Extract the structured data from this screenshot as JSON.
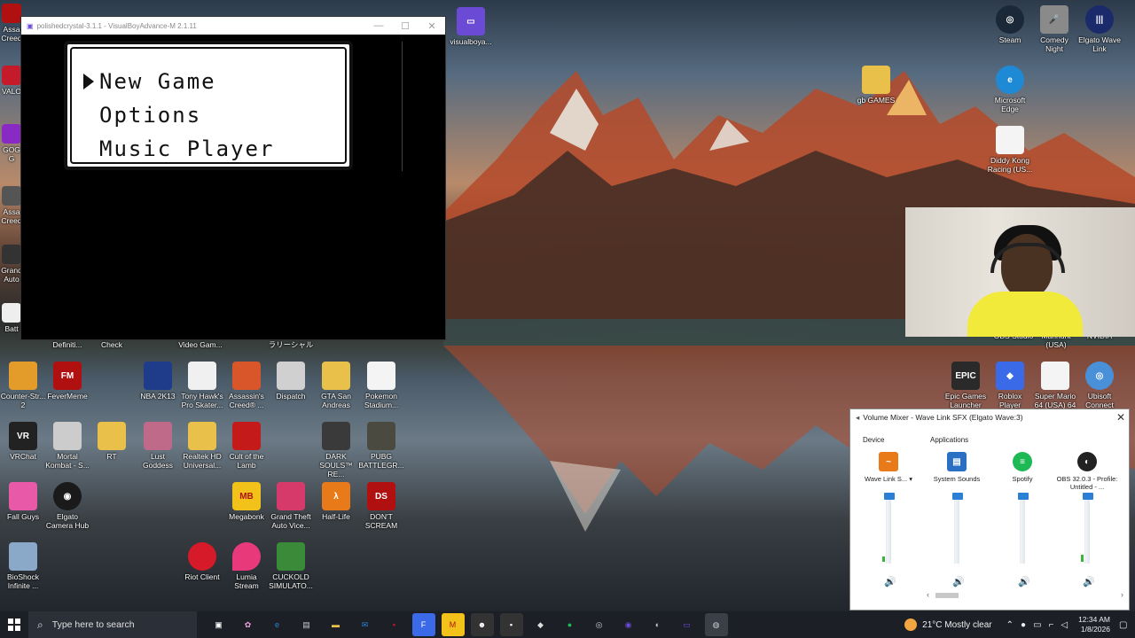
{
  "emulator": {
    "title": "polishedcrystal-3.1.1 - VisualBoyAdvance-M 2.1.11",
    "menu": [
      "New Game",
      "Options",
      "Music Player"
    ]
  },
  "desktop_icons": [
    {
      "key": "visualboy",
      "label": "visualboya...",
      "color": "#6b4bd6"
    },
    {
      "key": "steam",
      "label": "Steam",
      "color": "#1b2838"
    },
    {
      "key": "comedy",
      "label": "Comedy Night",
      "color": "#8a8a8a"
    },
    {
      "key": "elgato_wave",
      "label": "Elgato Wave Link",
      "color": "#1a2a6a"
    },
    {
      "key": "edge",
      "label": "Microsoft Edge",
      "color": "#1e8ad6"
    },
    {
      "key": "gb_games",
      "label": "gb GAMES",
      "color": "#e8c04a"
    },
    {
      "key": "diddy",
      "label": "Diddy Kong Racing (US...",
      "color": "#f4f4f4"
    },
    {
      "key": "obs_bg",
      "label": "OBS Studio",
      "color": "#333"
    },
    {
      "key": "manhunt",
      "label": "Manhunt (USA)",
      "color": "#555"
    },
    {
      "key": "nvidia",
      "label": "NVIDIA",
      "color": "#76b900"
    },
    {
      "key": "definiti",
      "label": "Definiti...",
      "color": "#555"
    },
    {
      "key": "check",
      "label": "Check",
      "color": "#555"
    },
    {
      "key": "videogam",
      "label": "Video Gam...",
      "color": "#555"
    },
    {
      "key": "jp",
      "label": "ラリーシャル",
      "color": "#555"
    },
    {
      "key": "cs",
      "label": "Counter-Str... 2",
      "color": "#e39b2a"
    },
    {
      "key": "fm",
      "label": "FeverMeme",
      "color": "#b01010"
    },
    {
      "key": "nba",
      "label": "NBA 2K13",
      "color": "#1e3c8a"
    },
    {
      "key": "thps",
      "label": "Tony Hawk's Pro Skater...",
      "color": "#f0f0f0"
    },
    {
      "key": "ac",
      "label": "Assassin's Creed® ...",
      "color": "#d9552a"
    },
    {
      "key": "dispatch",
      "label": "Dispatch",
      "color": "#d0d0d0"
    },
    {
      "key": "gta_sa",
      "label": "GTA San Andreas",
      "color": "#e8c04a"
    },
    {
      "key": "pokemon_stadium",
      "label": "Pokemon Stadium...",
      "color": "#f4f4f4"
    },
    {
      "key": "epic",
      "label": "Epic Games Launcher",
      "color": "#2a2a2a"
    },
    {
      "key": "roblox",
      "label": "Roblox Player",
      "color": "#3a6ae8"
    },
    {
      "key": "supermario",
      "label": "Super Mario 64 (USA) 64",
      "color": "#f4f4f4"
    },
    {
      "key": "ubisoft",
      "label": "Ubisoft Connect",
      "color": "#4a90d9"
    },
    {
      "key": "vrchat",
      "label": "VRChat",
      "color": "#222"
    },
    {
      "key": "mk",
      "label": "Mortal Kombat - S...",
      "color": "#ccc"
    },
    {
      "key": "rt",
      "label": "RT",
      "color": "#e8c04a"
    },
    {
      "key": "lust",
      "label": "Lust Goddess",
      "color": "#c06a8a"
    },
    {
      "key": "realtek",
      "label": "Realtek HD Universal...",
      "color": "#e8c04a"
    },
    {
      "key": "cult",
      "label": "Cult of the Lamb",
      "color": "#c41a1a"
    },
    {
      "key": "darksouls",
      "label": "DARK SOULS™ RE...",
      "color": "#3a3a3a"
    },
    {
      "key": "pubg",
      "label": "PUBG BATTLEGR...",
      "color": "#4a4a40"
    },
    {
      "key": "fallguys",
      "label": "Fall Guys",
      "color": "#e85aa8"
    },
    {
      "key": "elgato_cam",
      "label": "Elgato Camera Hub",
      "color": "#1a1a1a"
    },
    {
      "key": "megabonk",
      "label": "Megabonk",
      "color": "#f2c21a"
    },
    {
      "key": "gtav",
      "label": "Grand Theft Auto Vice...",
      "color": "#d63a6a"
    },
    {
      "key": "halflife",
      "label": "Half-Life",
      "color": "#e87a1a"
    },
    {
      "key": "dontscream",
      "label": "DON'T SCREAM",
      "color": "#b01010"
    },
    {
      "key": "bioshock",
      "label": "BioShock Infinite ...",
      "color": "#8aa8c8"
    },
    {
      "key": "riot",
      "label": "Riot Client",
      "color": "#d61a2a"
    },
    {
      "key": "lumia",
      "label": "Lumia Stream",
      "color": "#e83a7a"
    },
    {
      "key": "cuckold",
      "label": "CUCKOLD SIMULATO...",
      "color": "#3a8a3a"
    },
    {
      "key": "left_assas",
      "label": "Assa Creed",
      "color": "#b01010"
    },
    {
      "key": "left_valo",
      "label": "VALO",
      "color": "#c41a2a"
    },
    {
      "key": "left_gog",
      "label": "GOG G",
      "color": "#8a2ac4"
    },
    {
      "key": "left_assas2",
      "label": "Assa Creed",
      "color": "#555"
    },
    {
      "key": "left_grand",
      "label": "Grand Auto",
      "color": "#333"
    },
    {
      "key": "left_batt",
      "label": "Batt",
      "color": "#eee"
    }
  ],
  "mixer": {
    "title": "Volume Mixer - Wave Link SFX (Elgato Wave:3)",
    "device_header": "Device",
    "apps_header": "Applications",
    "columns": [
      {
        "name": "Wave Link S...",
        "level_pct": 8,
        "volume_pct": 100,
        "icon": "wave-link-icon",
        "color": "#e87a1a"
      },
      {
        "name": "System Sounds",
        "level_pct": 0,
        "volume_pct": 100,
        "icon": "system-sounds-icon",
        "color": "#2b6fc4"
      },
      {
        "name": "Spotify",
        "level_pct": 0,
        "volume_pct": 100,
        "icon": "spotify-icon",
        "color": "#1db954"
      },
      {
        "name": "OBS 32.0.3 - Profile: Untitled - ...",
        "level_pct": 10,
        "volume_pct": 100,
        "icon": "obs-icon",
        "color": "#222"
      }
    ]
  },
  "taskbar": {
    "search_placeholder": "Type here to search",
    "weather": "21°C  Mostly clear",
    "time": "12:34 AM",
    "date": "1/8/2026"
  }
}
